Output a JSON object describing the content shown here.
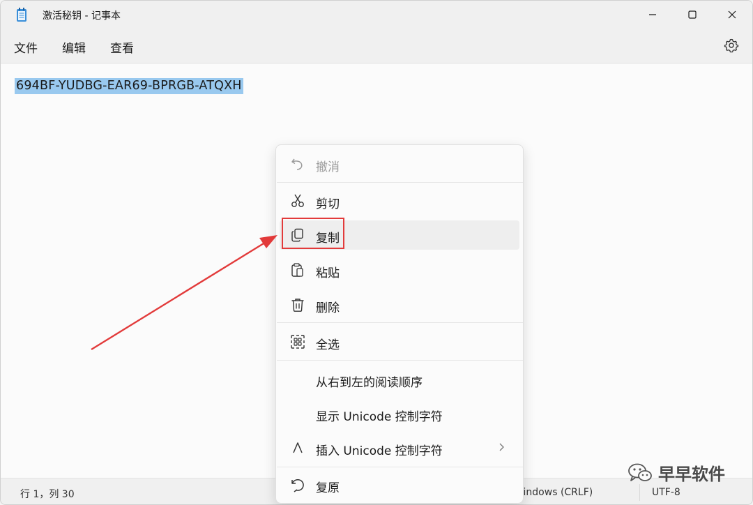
{
  "window": {
    "title": "激活秘钥 - 记事本"
  },
  "menubar": {
    "items": [
      "文件",
      "编辑",
      "查看"
    ]
  },
  "editor": {
    "content": "694BF-YUDBG-EAR69-BPRGB-ATQXH"
  },
  "context_menu": {
    "items": [
      {
        "label": "撤消",
        "icon": "undo-icon",
        "disabled": true
      },
      {
        "label": "剪切",
        "icon": "scissors-icon"
      },
      {
        "label": "复制",
        "icon": "copy-icon",
        "hover": true
      },
      {
        "label": "粘贴",
        "icon": "paste-icon"
      },
      {
        "label": "删除",
        "icon": "trash-icon"
      },
      {
        "label": "全选",
        "icon": "select-all-icon"
      },
      {
        "label": "从右到左的阅读顺序"
      },
      {
        "label": "显示 Unicode 控制字符"
      },
      {
        "label": "插入 Unicode 控制字符",
        "icon": "caret-up-icon",
        "submenu": true
      },
      {
        "label": "复原",
        "icon": "reconvert-icon"
      }
    ]
  },
  "statusbar": {
    "position": "行 1，列 30",
    "line_ending": "Windows (CRLF)",
    "encoding": "UTF-8"
  },
  "watermark": {
    "text": "早早软件"
  },
  "colors": {
    "selection": "#99c9ef",
    "annotation": "#e23a3a"
  }
}
